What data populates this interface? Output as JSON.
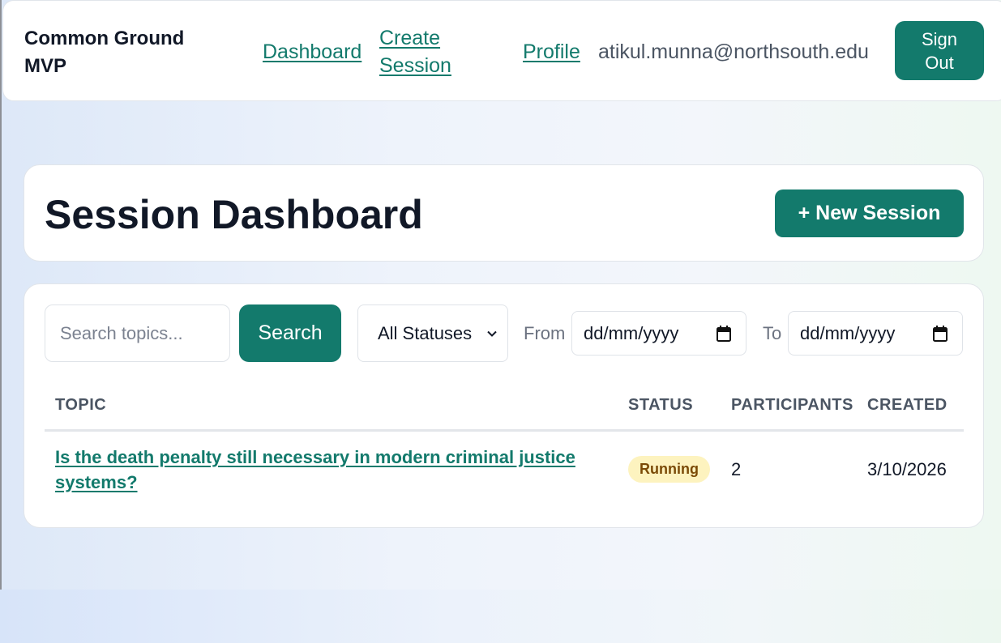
{
  "header": {
    "brand": "Common Ground MVP",
    "nav": {
      "dashboard": "Dashboard",
      "create_session": "Create Session",
      "profile": "Profile"
    },
    "user_email": "atikul.munna@northsouth.edu",
    "sign_out": "Sign Out"
  },
  "page": {
    "title": "Session Dashboard",
    "new_session_label": "+ New Session"
  },
  "filters": {
    "search_placeholder": "Search topics...",
    "search_button": "Search",
    "status_selected": "All Statuses",
    "from_label": "From",
    "to_label": "To",
    "from_value": "dd/mm/yyyy",
    "to_value": "dd/mm/yyyy"
  },
  "table": {
    "columns": [
      "TOPIC",
      "STATUS",
      "PARTICIPANTS",
      "CREATED"
    ],
    "rows": [
      {
        "topic": "Is the death penalty still necessary in modern criminal justice systems?",
        "status": "Running",
        "participants": "2",
        "created": "3/10/2026"
      }
    ]
  },
  "colors": {
    "accent": "#137a6c",
    "badge_running_bg": "#fdf3bf",
    "badge_running_text": "#7a4a06"
  }
}
